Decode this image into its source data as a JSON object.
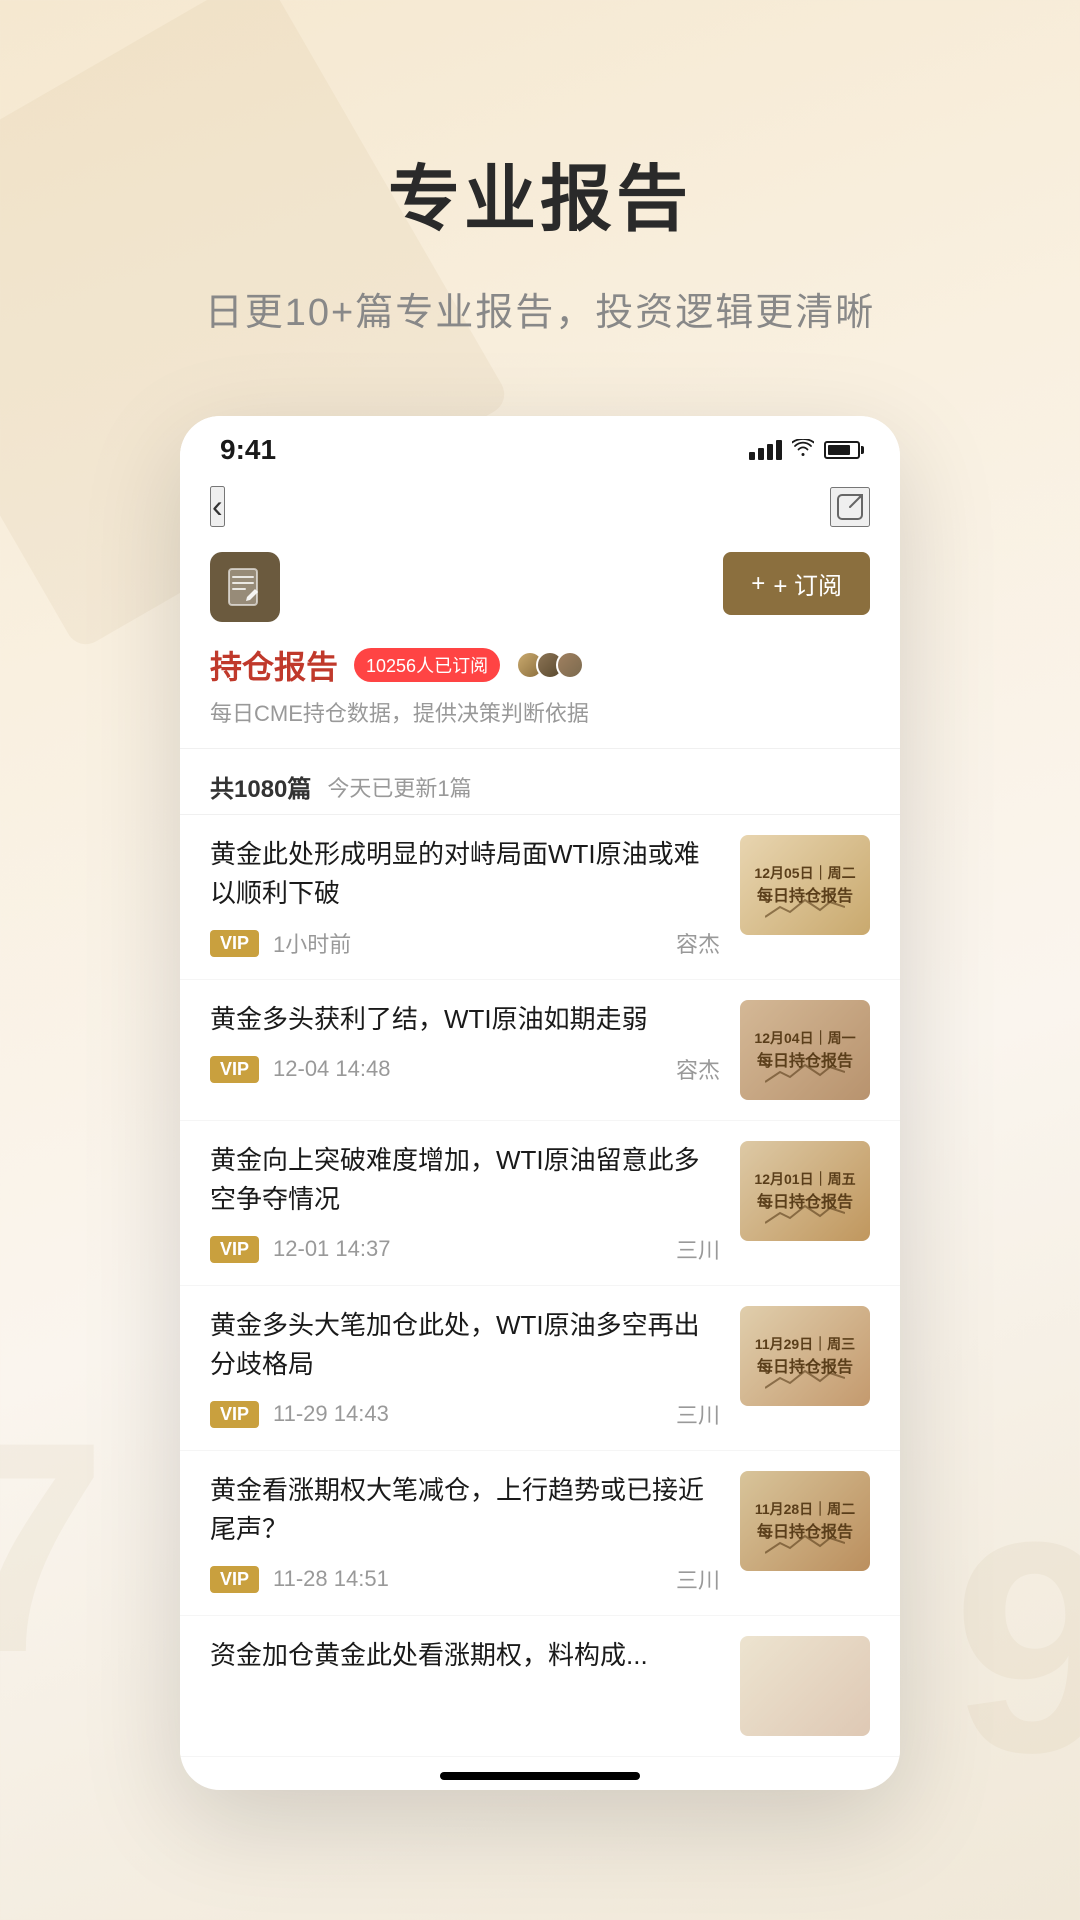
{
  "background": {
    "color": "#f5e8d0"
  },
  "header": {
    "title": "专业报告",
    "subtitle": "日更10+篇专业报告，投资逻辑更清晰"
  },
  "phone": {
    "status_bar": {
      "time": "9:41"
    },
    "nav": {
      "back_label": "‹",
      "share_label": "share"
    },
    "report": {
      "title": "持仓报告",
      "desc": "每日CME持仓数据，提供决策判断依据",
      "subscriber_count": "10256人已订阅",
      "subscribe_btn": "+ 订阅"
    },
    "article_list": {
      "total": "共1080篇",
      "today_update": "今天已更新1篇",
      "articles": [
        {
          "title": "黄金此处形成明显的对峙局面WTI原油或难以顺利下破",
          "vip": "VIP",
          "time": "1小时前",
          "author": "容杰",
          "thumb_date": "12月05日｜周二",
          "thumb_label": "每日持仓报告",
          "thumb_class": "thumb-1"
        },
        {
          "title": "黄金多头获利了结，WTI原油如期走弱",
          "vip": "VIP",
          "time": "12-04  14:48",
          "author": "容杰",
          "thumb_date": "12月04日｜周一",
          "thumb_label": "每日持仓报告",
          "thumb_class": "thumb-2"
        },
        {
          "title": "黄金向上突破难度增加，WTI原油留意此多空争夺情况",
          "vip": "VIP",
          "time": "12-01  14:37",
          "author": "三川",
          "thumb_date": "12月01日｜周五",
          "thumb_label": "每日持仓报告",
          "thumb_class": "thumb-3"
        },
        {
          "title": "黄金多头大笔加仓此处，WTI原油多空再出分歧格局",
          "vip": "VIP",
          "time": "11-29  14:43",
          "author": "三川",
          "thumb_date": "11月29日｜周三",
          "thumb_label": "每日持仓报告",
          "thumb_class": "thumb-4"
        },
        {
          "title": "黄金看涨期权大笔减仓，上行趋势或已接近尾声？",
          "vip": "VIP",
          "time": "11-28  14:51",
          "author": "三川",
          "thumb_date": "11月28日｜周二",
          "thumb_label": "每日持仓报告",
          "thumb_class": "thumb-5"
        },
        {
          "title": "资金加仓黄金此处看涨期权，料构成...",
          "vip": "",
          "time": "",
          "author": "",
          "thumb_date": "",
          "thumb_label": "",
          "thumb_class": "thumb-6"
        }
      ]
    }
  },
  "bg_numbers": [
    "7",
    "9"
  ]
}
